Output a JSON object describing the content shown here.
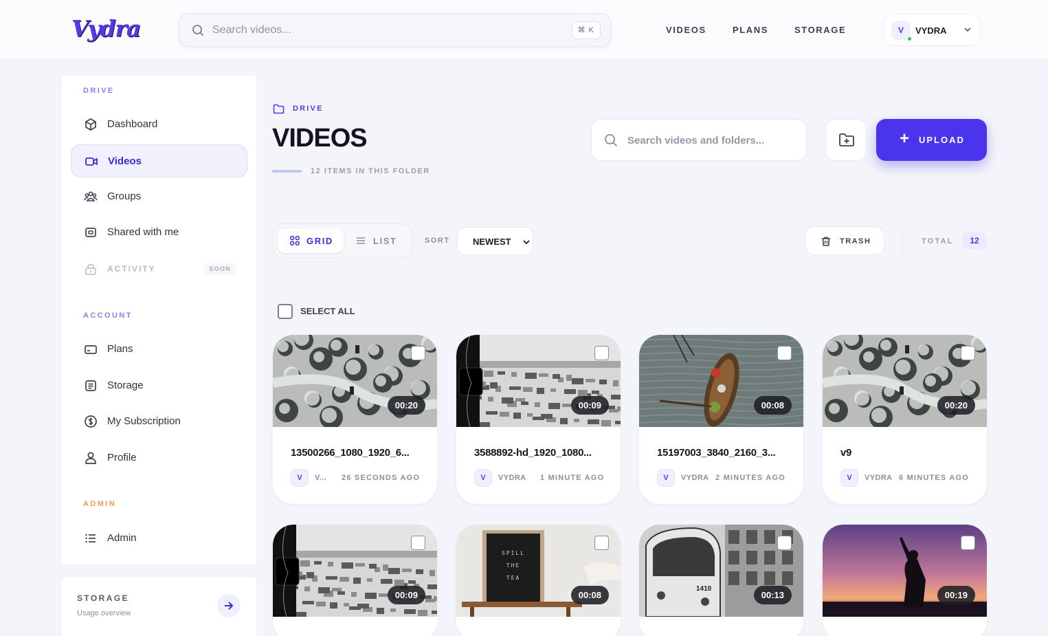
{
  "app": {
    "logo": "Vydra"
  },
  "topbar": {
    "search_placeholder": "Search videos...",
    "search_shortcut": "⌘ K",
    "nav": [
      "VIDEOS",
      "PLANS",
      "STORAGE"
    ],
    "user": {
      "initial": "V",
      "name": "VYDRA",
      "status_color": "#23c55e"
    }
  },
  "sidebar": {
    "drive_label": "DRIVE",
    "drive_items": [
      {
        "label": "Dashboard",
        "icon": "cube-icon"
      },
      {
        "label": "Videos",
        "icon": "video-camera-icon",
        "active": true
      },
      {
        "label": "Groups",
        "icon": "groups-icon"
      },
      {
        "label": "Shared with me",
        "icon": "shared-icon"
      },
      {
        "label": "ACTIVITY",
        "icon": "lock-icon",
        "badge": "SOON"
      }
    ],
    "account_label": "ACCOUNT",
    "account_items": [
      {
        "label": "Plans",
        "icon": "card-icon"
      },
      {
        "label": "Storage",
        "icon": "storage-icon"
      },
      {
        "label": "My Subscription",
        "icon": "dollar-icon"
      },
      {
        "label": "Profile",
        "icon": "user-icon"
      }
    ],
    "admin_label": "ADMIN",
    "admin_items": [
      {
        "label": "Admin",
        "icon": "list-icon"
      }
    ],
    "storage_card": {
      "title": "STORAGE",
      "subtitle": "Usage overview"
    }
  },
  "main": {
    "breadcrumb": "DRIVE",
    "title": "VIDEOS",
    "item_count": "12 ITEMS IN THIS FOLDER",
    "search_placeholder": "Search videos and folders...",
    "upload_label": "UPLOAD",
    "view_grid": "GRID",
    "view_list": "LIST",
    "sort_label": "SORT",
    "sort_value": "NEWEST",
    "trash_label": "TRASH",
    "total_label": "TOTAL",
    "total_value": "12",
    "select_all": "SELECT ALL"
  },
  "videos": [
    {
      "name": "13500266_1080_1920_6...",
      "duration": "00:20",
      "user": "V...",
      "user_initial": "V",
      "ago": "26 SECONDS AGO",
      "thumb": "snow-forest"
    },
    {
      "name": "3588892-hd_1920_1080...",
      "duration": "00:09",
      "user": "VYDRA",
      "user_initial": "V",
      "ago": "1 MINUTE AGO",
      "thumb": "city-bw"
    },
    {
      "name": "15197003_3840_2160_3...",
      "duration": "00:08",
      "user": "VYDRA",
      "user_initial": "V",
      "ago": "2 MINUTES AGO",
      "thumb": "boat"
    },
    {
      "name": "v9",
      "duration": "00:20",
      "user": "VYDRA",
      "user_initial": "V",
      "ago": "6 MINUTES AGO",
      "thumb": "snow-forest"
    },
    {
      "name": "",
      "duration": "00:09",
      "thumb": "city-bw"
    },
    {
      "name": "",
      "duration": "00:08",
      "thumb": "spill-tea",
      "sign_text": [
        "SPILL",
        "THE",
        "TEA"
      ]
    },
    {
      "name": "",
      "duration": "00:13",
      "thumb": "train",
      "train_number": "1410"
    },
    {
      "name": "",
      "duration": "00:19",
      "thumb": "sunset"
    }
  ],
  "colors": {
    "accent": "#4a35ec",
    "admin": "#f39a54",
    "section": "#8a7ff0"
  }
}
